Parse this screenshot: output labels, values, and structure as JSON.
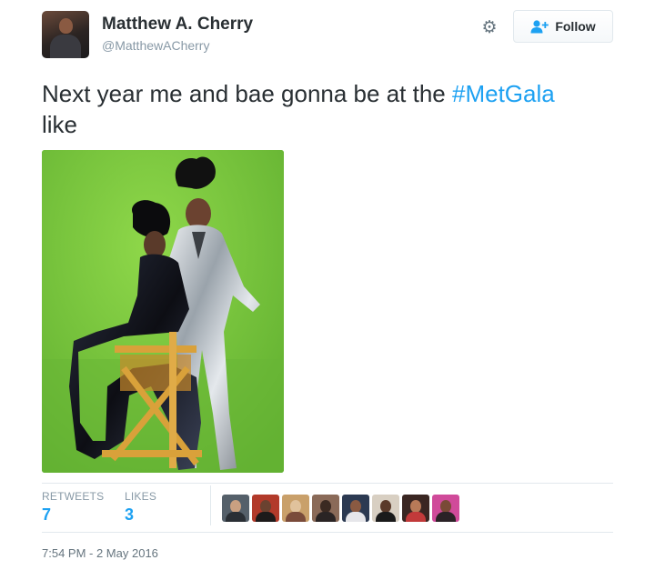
{
  "author": {
    "display_name": "Matthew A. Cherry",
    "screen_name": "@MatthewACherry"
  },
  "actions": {
    "settings_icon": "gear-icon",
    "follow_icon": "add-user-icon",
    "follow_label": "Follow"
  },
  "tweet": {
    "text_before": "Next year me and bae gonna be at the ",
    "hashtag": "#MetGala",
    "text_after": " like"
  },
  "stats": {
    "retweets_label": "RETWEETS",
    "retweets_count": "7",
    "likes_label": "LIKES",
    "likes_count": "3"
  },
  "likers_count_shown": 8,
  "timestamp": "7:54 PM - 2 May 2016",
  "colors": {
    "link": "#1da1f2",
    "text": "#292f33",
    "muted": "#8899a6",
    "border": "#e1e8ed",
    "photo_background": "#74c23a"
  }
}
